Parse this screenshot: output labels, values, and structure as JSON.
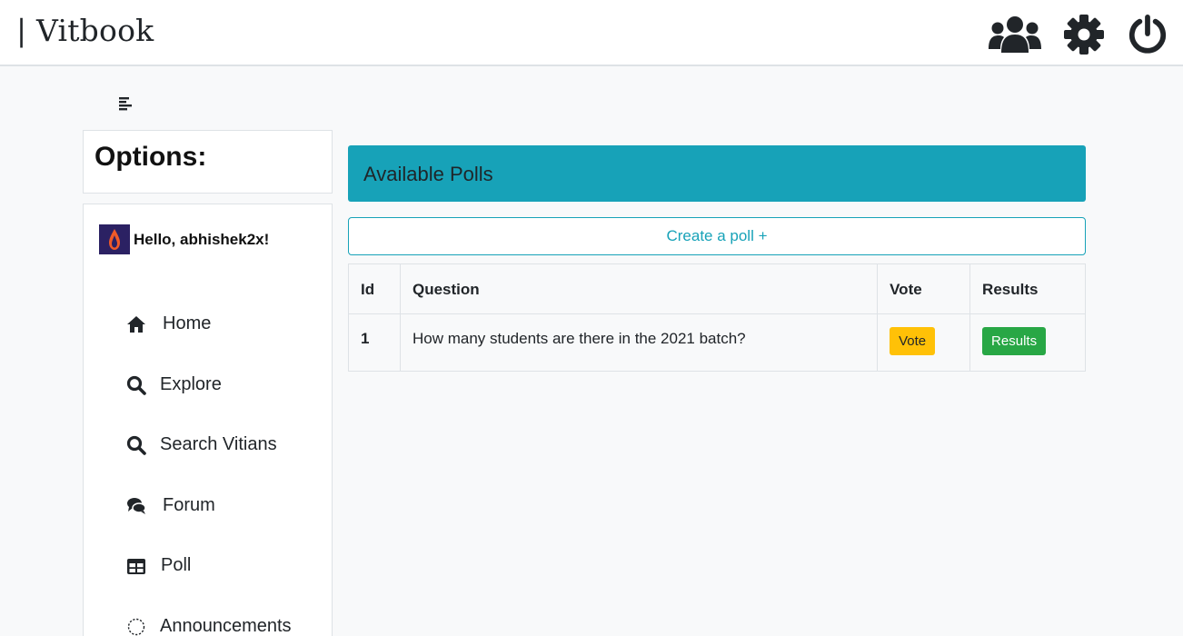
{
  "header": {
    "brand": "| Vitbook",
    "icons": [
      "users-icon",
      "gear-icon",
      "power-icon"
    ]
  },
  "sidebar": {
    "toggle_icon": "align-left-icon",
    "options_title": "Options:",
    "greeting": "Hello, abhishek2x!",
    "items": [
      {
        "label": "Home",
        "icon": "home-icon"
      },
      {
        "label": "Explore",
        "icon": "search-icon"
      },
      {
        "label": "Search Vitians",
        "icon": "search-icon"
      },
      {
        "label": "Forum",
        "icon": "comments-icon"
      },
      {
        "label": "Poll",
        "icon": "table-icon"
      },
      {
        "label": "Announcements",
        "icon": "circle-dashed-icon"
      }
    ]
  },
  "main": {
    "title": "Available Polls",
    "create_label": "Create a poll +",
    "table": {
      "columns": [
        "Id",
        "Question",
        "Vote",
        "Results"
      ],
      "rows": [
        {
          "id": "1",
          "question": "How many students are there in the 2021 batch?",
          "vote_label": "Vote",
          "results_label": "Results"
        }
      ]
    }
  },
  "colors": {
    "accent": "#17a2b8",
    "vote": "#ffc107",
    "results": "#28a745"
  }
}
